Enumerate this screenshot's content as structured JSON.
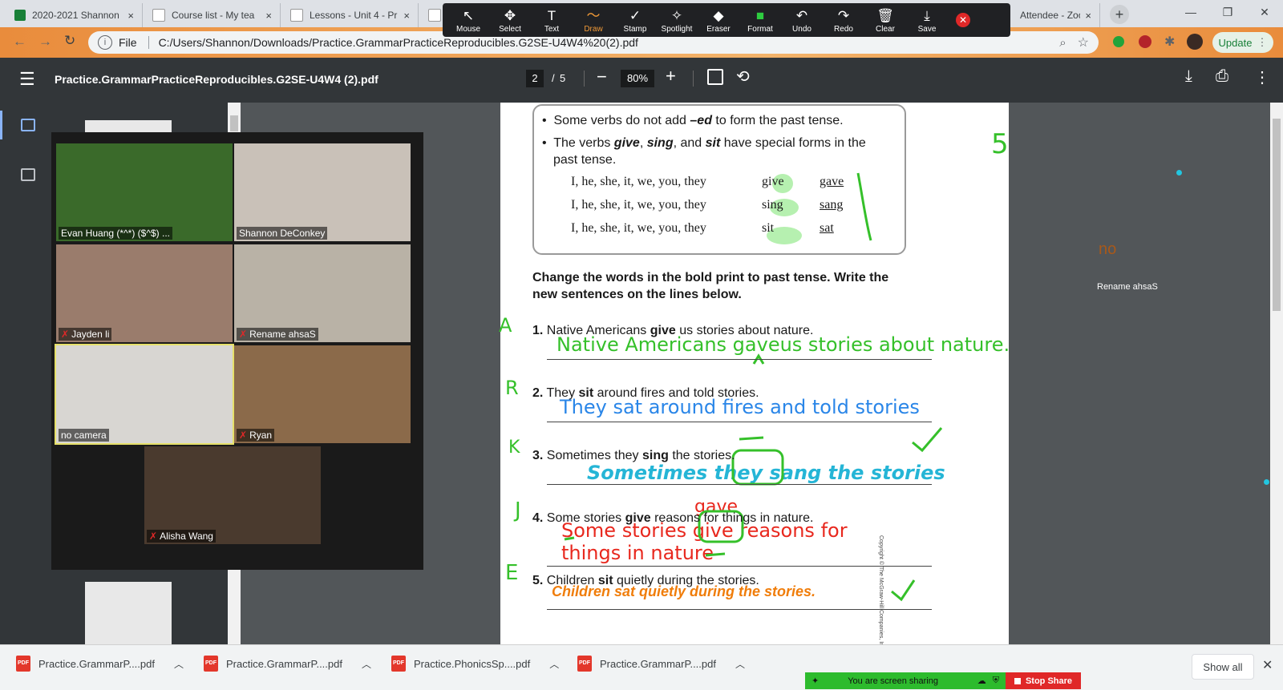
{
  "browser": {
    "tabs": [
      {
        "title": "2020-2021 Shannon",
        "color": "#188038"
      },
      {
        "title": "Course list - My tea",
        "color": "#ffffff"
      },
      {
        "title": "Lessons - Unit 4 - Pr",
        "color": "#ffffff"
      },
      {
        "title": "",
        "color": "#ffffff"
      },
      {
        "title": "Attendee - Zoo",
        "color": "#2d8cff"
      }
    ],
    "address_prefix": "File",
    "address": "C:/Users/Shannon/Downloads/Practice.GrammarPracticeReproducibles.G2SE-U4W4%20(2).pdf",
    "update_label": "Update"
  },
  "zoom_toolbar": {
    "tools": [
      {
        "label": "Mouse",
        "icon": "↖"
      },
      {
        "label": "Select",
        "icon": "✥"
      },
      {
        "label": "Text",
        "icon": "T"
      },
      {
        "label": "Draw",
        "icon": "〜"
      },
      {
        "label": "Stamp",
        "icon": "✓"
      },
      {
        "label": "Spotlight",
        "icon": "✧"
      },
      {
        "label": "Eraser",
        "icon": "◆"
      },
      {
        "label": "Format",
        "icon": "■"
      },
      {
        "label": "Undo",
        "icon": "↶"
      },
      {
        "label": "Redo",
        "icon": "↷"
      },
      {
        "label": "Clear",
        "icon": "🗑"
      },
      {
        "label": "Save",
        "icon": "⤓"
      }
    ],
    "active": "Draw",
    "format_color": "#2ecc40"
  },
  "pdf_viewer": {
    "title": "Practice.GrammarPracticeReproducibles.G2SE-U4W4 (2).pdf",
    "page_current": "2",
    "page_total": "5",
    "zoom": "80%"
  },
  "gallery": [
    {
      "name": "Evan Huang (*^*) ($^$) ...",
      "muted": false,
      "bg": "#3a6a2a"
    },
    {
      "name": "Shannon DeConkey",
      "muted": false,
      "bg": "#c9c1b8"
    },
    {
      "name": "Jayden li",
      "muted": true,
      "bg": "#9a7c6c"
    },
    {
      "name": "Rename ahsaS",
      "muted": true,
      "bg": "#b9b2a6"
    },
    {
      "name": "no camera",
      "muted": false,
      "bg": "#d8d6d2"
    },
    {
      "name": "Ryan",
      "muted": true,
      "bg": "#8b6a4a"
    },
    {
      "name": "Alisha Wang",
      "muted": true,
      "bg": "#4a3a2e"
    }
  ],
  "worksheet": {
    "rule_1": "Some verbs do not add",
    "rule_1_bold": "–ed",
    "rule_1_end": "to form the past tense.",
    "rule_2a": "The verbs",
    "rule_2_give": "give",
    "rule_2_sing": "sing",
    "rule_2_and": ", and",
    "rule_2_sit": "sit",
    "rule_2b": "have special forms in the",
    "rule_2c": "past tense.",
    "table": [
      {
        "subject": "I, he, she, it, we, you, they",
        "present": "give",
        "past": "gave"
      },
      {
        "subject": "I, he, she, it, we, you, they",
        "present": "sing",
        "past": "sang"
      },
      {
        "subject": "I, he, she, it, we, you, they",
        "present": "sit",
        "past": "sat"
      }
    ],
    "instructions_1": "Change the words in the bold print to past tense. Write the",
    "instructions_2": "new sentences on the lines below.",
    "items": [
      {
        "num": "1.",
        "pre": "Native Americans",
        "bold": "give",
        "post": "us stories about nature."
      },
      {
        "num": "2.",
        "pre": "They",
        "bold": "sit",
        "post": "around fires and told stories."
      },
      {
        "num": "3.",
        "pre": "Sometimes they",
        "bold": "sing",
        "post": "the stories."
      },
      {
        "num": "4.",
        "pre": "Some stories",
        "bold": "give",
        "post": "reasons for things in nature."
      },
      {
        "num": "5.",
        "pre": "Children",
        "bold": "sit",
        "post": "quietly during the stories."
      }
    ],
    "copyright": "Copyright © The McGraw-Hill Companies, Inc."
  },
  "annotations": {
    "answer_1": "Native Americans gaveus stories about nature.",
    "answer_2": "They sat around fires and told stories",
    "answer_3": "Sometimes they sang the stories",
    "answer_4a": "Some stories give reasons for",
    "answer_4b": "things in nature",
    "answer_4_correction": "gave",
    "answer_5": "Children sat quietly during the stories.",
    "initial_1": "A",
    "initial_2": "R",
    "initial_3": "K",
    "initial_4": "J",
    "initial_5": "E",
    "count_mark": "5",
    "side_no": "no",
    "side_rename": "Rename ahsaS",
    "colors": {
      "green": "#35c02a",
      "blue": "#2a86e8",
      "cyan": "#25b5d6",
      "red": "#e8281e",
      "orange": "#f07d0a"
    }
  },
  "downloads": [
    {
      "name": "Practice.GrammarP....pdf"
    },
    {
      "name": "Practice.GrammarP....pdf"
    },
    {
      "name": "Practice.PhonicsSp....pdf"
    },
    {
      "name": "Practice.GrammarP....pdf"
    }
  ],
  "show_all_label": "Show all",
  "screen_share": {
    "status": "You are screen sharing",
    "stop": "Stop Share"
  }
}
